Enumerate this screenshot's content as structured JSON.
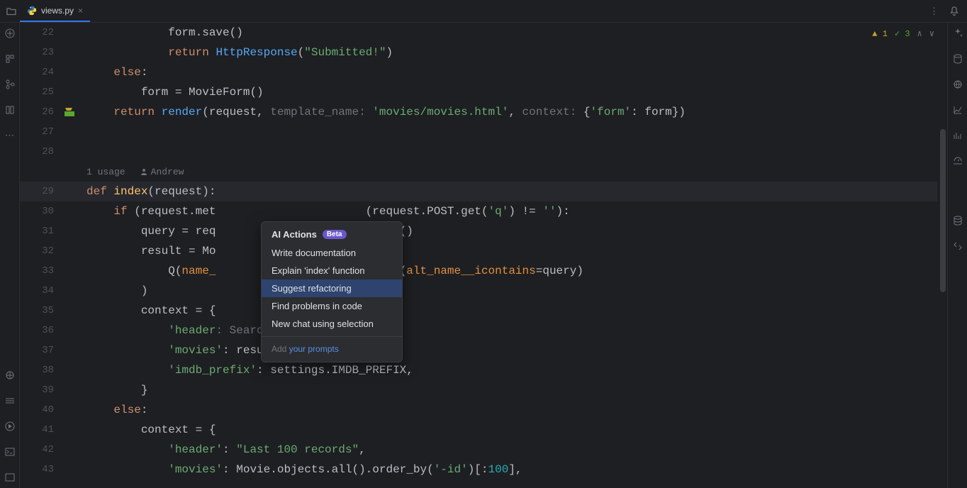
{
  "tab": {
    "filename": "views.py"
  },
  "status": {
    "warnings": "1",
    "checks": "3"
  },
  "usage": {
    "label": "1 usage",
    "author": "Andrew"
  },
  "popup": {
    "title": "AI Actions",
    "badge": "Beta",
    "items": [
      "Write documentation",
      "Explain 'index' function",
      "Suggest refactoring",
      "Find problems in code",
      "New chat using selection"
    ],
    "footer_prefix": "Add ",
    "footer_link": "your prompts"
  },
  "code": {
    "l22": "            form.save()",
    "l23a": "            ",
    "l23_return": "return ",
    "l23_fn": "HttpResponse",
    "l23b": "(",
    "l23_s": "\"Submitted!\"",
    "l23c": ")",
    "l24a": "    ",
    "l24_else": "else",
    "l24b": ":",
    "l25": "        form = MovieForm()",
    "l26a": "    ",
    "l26_return": "return ",
    "l26_fn": "render",
    "l26b": "(request, ",
    "l26_p1": "template_name:",
    "l26c": " ",
    "l26_s": "'movies/movies.html'",
    "l26d": ", ",
    "l26_p2": "context:",
    "l26e": " {",
    "l26_s2": "'form'",
    "l26f": ": form})",
    "l29_def": "def ",
    "l29_name": "index",
    "l29b": "(request):",
    "l30a": "    ",
    "l30_if": "if ",
    "l30b": "(request.met",
    "l30c": "(request.POST.get(",
    "l30_s": "'q'",
    "l30d": ") != ",
    "l30_s2": "''",
    "l30e": "):",
    "l31": "        query = req",
    "l31b": "strip()",
    "l32": "        result = Mo",
    "l33a": "            Q(",
    "l33_k": "name_",
    "l33b": " Q(",
    "l33_k2": "alt_name__icontains",
    "l33c": "=query)",
    "l34": "        )",
    "l35": "        context = {",
    "l36a": "            ",
    "l36_s": "'header",
    "l36b": ": ",
    "l36_s2": "Search results",
    "l36c": ",",
    "l37a": "            ",
    "l37_s": "'movies'",
    "l37b": ": result,",
    "l38a": "            ",
    "l38_s": "'imdb_prefix'",
    "l38b": ": settings.IMDB_PREFIX,",
    "l39": "        }",
    "l40a": "    ",
    "l40_else": "else",
    "l40b": ":",
    "l41": "        context = {",
    "l42a": "            ",
    "l42_s": "'header'",
    "l42b": ": ",
    "l42_s2": "\"Last 100 records\"",
    "l42c": ",",
    "l43a": "            ",
    "l43_s": "'movies'",
    "l43b": ": Movie.objects.all().order_by(",
    "l43_s2": "'-id'",
    "l43c": ")[:",
    "l43_n": "100",
    "l43d": "],"
  }
}
